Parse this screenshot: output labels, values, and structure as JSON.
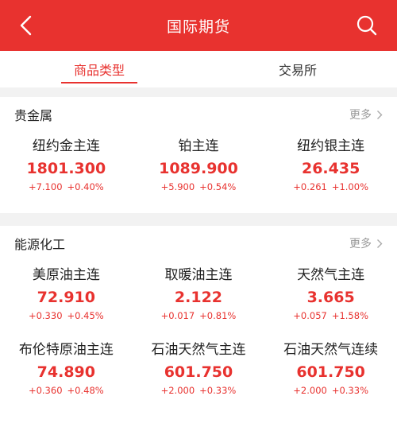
{
  "header": {
    "title": "国际期货",
    "back_icon": "back-chevron-icon",
    "search_icon": "search-icon",
    "color": "#e8322f"
  },
  "tabs": [
    {
      "label": "商品类型",
      "active": true
    },
    {
      "label": "交易所",
      "active": false
    }
  ],
  "sections": [
    {
      "title": "贵金属",
      "more_label": "更多",
      "items": [
        {
          "name": "纽约金主连",
          "price": "1801.300",
          "change": "+7.100",
          "percent": "+0.40%"
        },
        {
          "name": "铂主连",
          "price": "1089.900",
          "change": "+5.900",
          "percent": "+0.54%"
        },
        {
          "name": "纽约银主连",
          "price": "26.435",
          "change": "+0.261",
          "percent": "+1.00%"
        }
      ]
    },
    {
      "title": "能源化工",
      "more_label": "更多",
      "items": [
        {
          "name": "美原油主连",
          "price": "72.910",
          "change": "+0.330",
          "percent": "+0.45%"
        },
        {
          "name": "取暖油主连",
          "price": "2.122",
          "change": "+0.017",
          "percent": "+0.81%"
        },
        {
          "name": "天然气主连",
          "price": "3.665",
          "change": "+0.057",
          "percent": "+1.58%"
        },
        {
          "name": "布伦特原油主连",
          "price": "74.890",
          "change": "+0.360",
          "percent": "+0.48%"
        },
        {
          "name": "石油天然气主连",
          "price": "601.750",
          "change": "+2.000",
          "percent": "+0.33%"
        },
        {
          "name": "石油天然气连续",
          "price": "601.750",
          "change": "+2.000",
          "percent": "+0.33%"
        }
      ]
    }
  ],
  "up_color": "#e8322f"
}
